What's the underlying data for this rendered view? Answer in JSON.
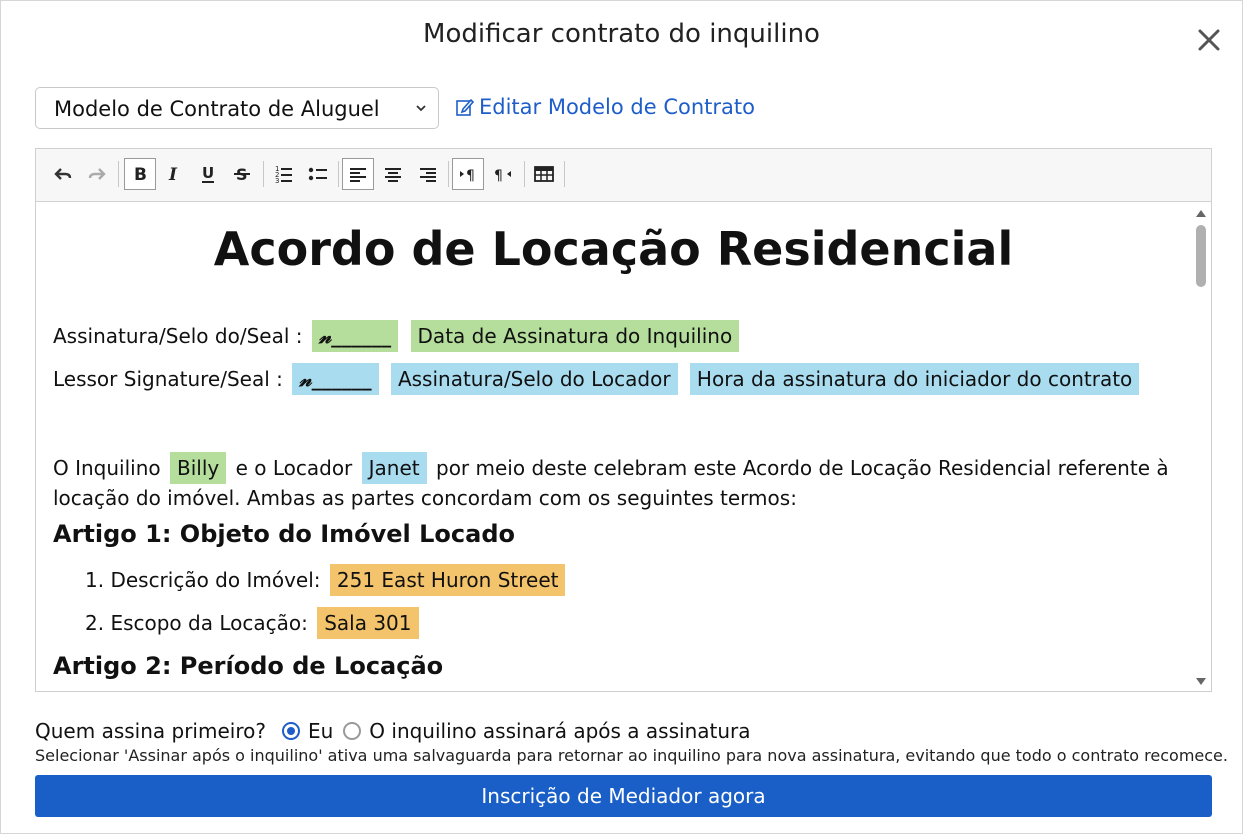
{
  "modal": {
    "title": "Modificar contrato do inquilino"
  },
  "template": {
    "selected": "Modelo de Contrato de Aluguel",
    "edit_link": "Editar Modelo de Contrato"
  },
  "toolbar": {
    "buttons": [
      "undo-icon",
      "redo-icon",
      "bold-icon",
      "italic-icon",
      "underline-icon",
      "strikethrough-icon",
      "ordered-list-icon",
      "bullet-list-icon",
      "align-left-icon",
      "align-center-icon",
      "align-right-icon",
      "ltr-icon",
      "rtl-icon",
      "table-icon"
    ],
    "active": [
      "bold-icon",
      "align-left-icon",
      "ltr-icon"
    ]
  },
  "document": {
    "title": "Acordo de Locação Residencial",
    "tenant_sig_label": "Assinatura/Selo do/Seal :",
    "tenant_sig_mark": "𝓃______",
    "tenant_date_field": "Data de Assinatura do Inquilino",
    "lessor_sig_label": "Lessor Signature/Seal :",
    "lessor_sig_mark": "𝓃______",
    "lessor_seal_field": "Assinatura/Selo do Locador",
    "initiator_time_field": "Hora da assinatura do iniciador do contrato",
    "intro": {
      "p1": "O Inquilino",
      "tenant": "Billy",
      "p2": "e o Locador",
      "lessor": "Janet",
      "p3": "por meio deste celebram este Acordo de Locação Residencial referente à locação do imóvel. Ambas as partes concordam com os seguintes termos:"
    },
    "article1": "Artigo 1: Objeto do Imóvel Locado",
    "item1_label": "1. Descrição do Imóvel:",
    "item1_value": "251 East Huron Street",
    "item2_label": "2. Escopo da Locação:",
    "item2_value": "Sala 301",
    "article2": "Artigo 2: Período de Locação"
  },
  "signing": {
    "question": "Quem assina primeiro?",
    "option_me": "Eu",
    "option_tenant": "O inquilino assinará após a assinatura",
    "selected": "Eu",
    "hint": "Selecionar 'Assinar após o inquilino' ativa uma salvaguarda para retornar ao inquilino para nova assinatura, evitando que todo o contrato recomece."
  },
  "cta": {
    "label": "Inscrição de Mediador agora"
  },
  "colors": {
    "accent": "#1a5fc7",
    "green_field": "#b5dd9b",
    "blue_field": "#a9dcef",
    "orange_field": "#f3c46b"
  }
}
